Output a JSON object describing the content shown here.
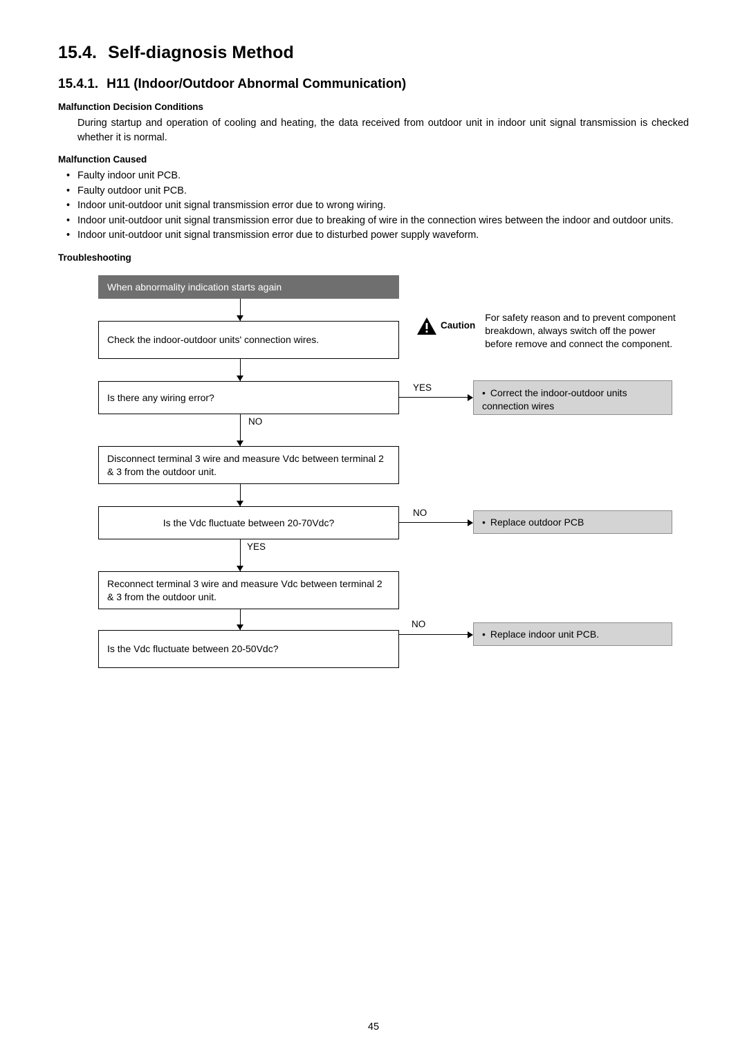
{
  "document": {
    "section": {
      "number": "15.4.",
      "title": "Self-diagnosis Method"
    },
    "subsection": {
      "number": "15.4.1.",
      "title": "H11 (Indoor/Outdoor Abnormal Communication)"
    },
    "decision_conditions": {
      "heading": "Malfunction Decision Conditions",
      "text": "During startup and operation of cooling and heating, the data received from outdoor unit in indoor unit signal transmission is checked whether it is normal."
    },
    "malfunction_caused": {
      "heading": "Malfunction Caused",
      "items": [
        "Faulty indoor unit PCB.",
        "Faulty outdoor unit PCB.",
        "Indoor unit-outdoor unit signal transmission error due to wrong wiring.",
        "Indoor unit-outdoor unit signal transmission error due to breaking of wire in the connection wires between the indoor and outdoor units.",
        "Indoor unit-outdoor unit signal transmission error due to disturbed power supply waveform."
      ]
    },
    "troubleshooting": {
      "heading": "Troubleshooting",
      "start_box": "When abnormality indication starts again",
      "steps": [
        "Check the indoor-outdoor units' connection wires.",
        "Is there any wiring error?",
        "Disconnect terminal 3 wire and measure Vdc between terminal 2 & 3 from the outdoor unit.",
        "Is the Vdc fluctuate between 20-70Vdc?",
        "Reconnect terminal 3 wire and measure Vdc between terminal 2 & 3 from the outdoor unit.",
        "Is the Vdc fluctuate between 20-50Vdc?"
      ],
      "results": [
        "Correct the indoor-outdoor units connection wires",
        "Replace outdoor PCB",
        "Replace indoor unit PCB."
      ],
      "labels": {
        "yes1": "YES",
        "no1": "NO",
        "no2": "NO",
        "yes2": "YES",
        "no3": "NO"
      },
      "caution": {
        "label": "Caution",
        "icon": "warning-triangle-icon",
        "text": "For safety reason and to prevent component breakdown, always switch off the power before remove and connect the component."
      }
    },
    "page_number": "45",
    "colors": {
      "header_box_bg": "#6f6f6f",
      "result_box_bg": "#d4d4d4",
      "result_box_border": "#8d8d8d",
      "line": "#000000"
    }
  }
}
